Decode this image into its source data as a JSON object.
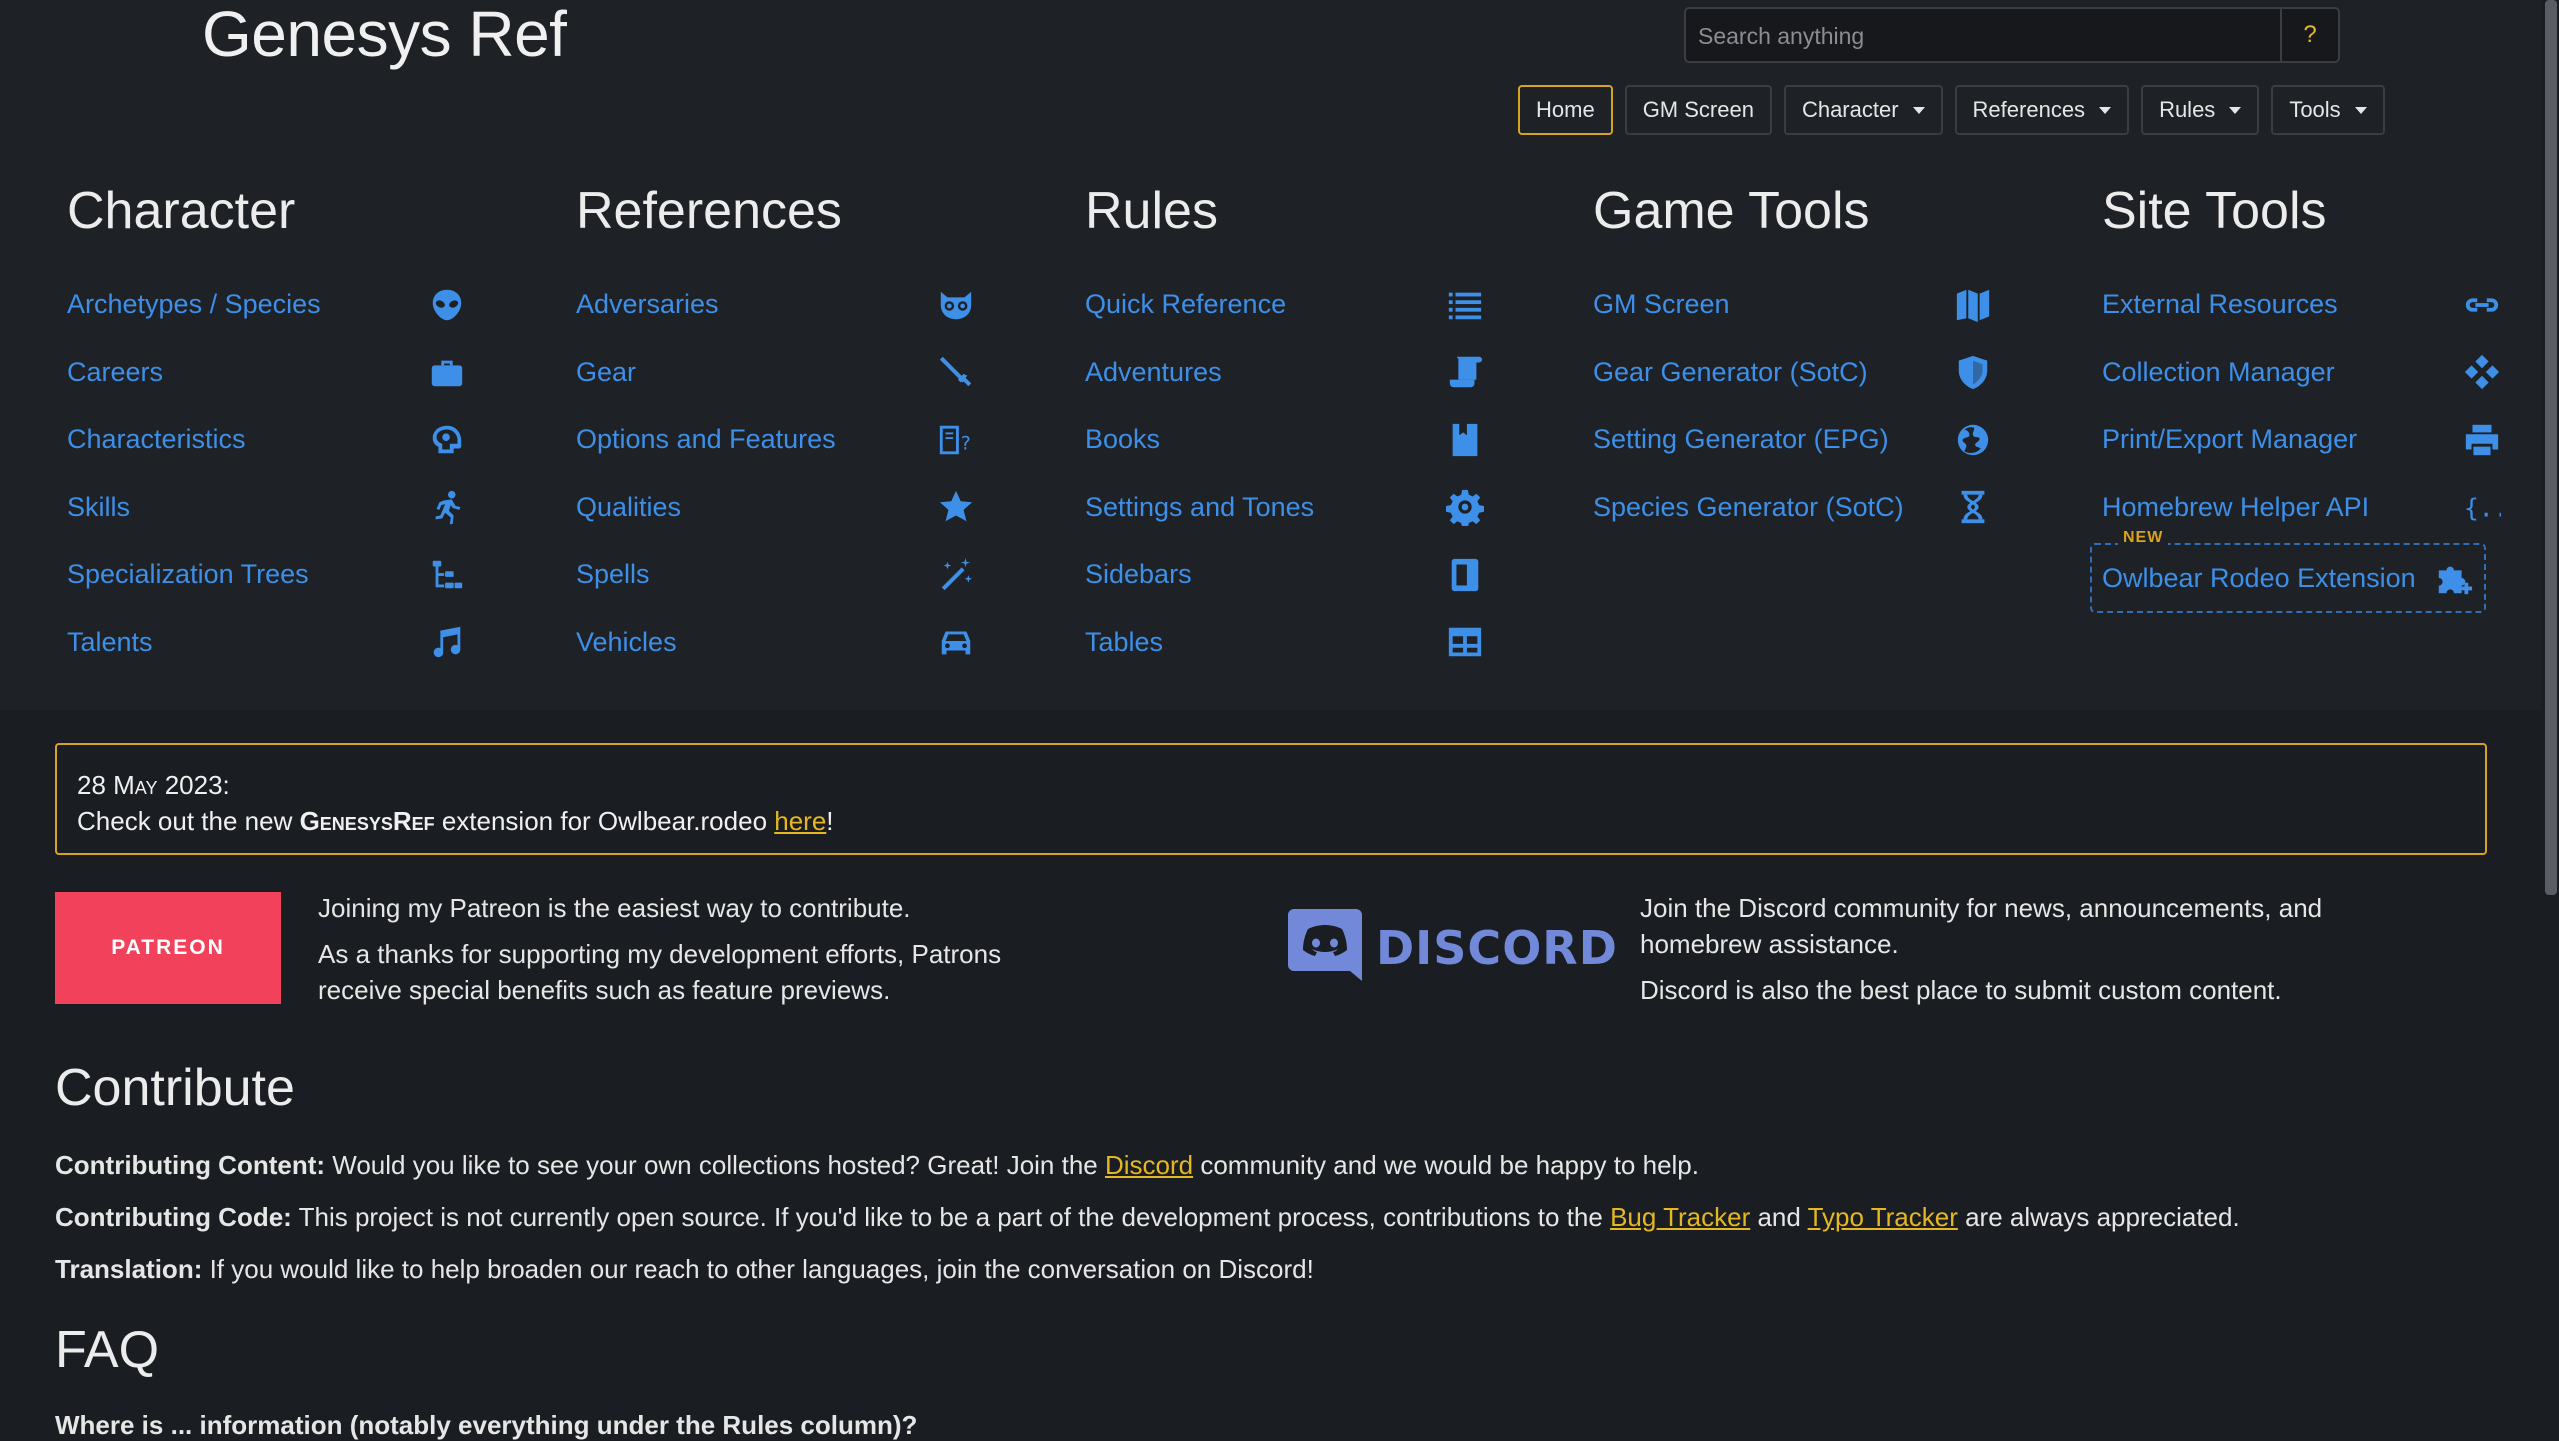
{
  "site": {
    "title": "Genesys Ref"
  },
  "search": {
    "placeholder": "Search anything",
    "help": "?"
  },
  "nav": [
    {
      "label": "Home"
    },
    {
      "label": "GM Screen"
    },
    {
      "label": "Character"
    },
    {
      "label": "References"
    },
    {
      "label": "Rules"
    },
    {
      "label": "Tools"
    }
  ],
  "columns": [
    {
      "heading": "Character",
      "items": [
        {
          "label": "Archetypes / Species",
          "icon": "alien-icon"
        },
        {
          "label": "Careers",
          "icon": "briefcase-icon"
        },
        {
          "label": "Characteristics",
          "icon": "brain-icon"
        },
        {
          "label": "Skills",
          "icon": "running-icon"
        },
        {
          "label": "Specialization Trees",
          "icon": "tree-icon"
        },
        {
          "label": "Talents",
          "icon": "music-icon"
        }
      ]
    },
    {
      "heading": "References",
      "items": [
        {
          "label": "Adversaries",
          "icon": "mask-icon"
        },
        {
          "label": "Gear",
          "icon": "sword-icon"
        },
        {
          "label": "Options and Features",
          "icon": "book-question-icon"
        },
        {
          "label": "Qualities",
          "icon": "star-icon"
        },
        {
          "label": "Spells",
          "icon": "magic-wand-icon"
        },
        {
          "label": "Vehicles",
          "icon": "car-icon"
        }
      ]
    },
    {
      "heading": "Rules",
      "items": [
        {
          "label": "Quick Reference",
          "icon": "list-icon"
        },
        {
          "label": "Adventures",
          "icon": "scroll-icon"
        },
        {
          "label": "Books",
          "icon": "book-icon"
        },
        {
          "label": "Settings and Tones",
          "icon": "gear-icon"
        },
        {
          "label": "Sidebars",
          "icon": "sidebar-icon"
        },
        {
          "label": "Tables",
          "icon": "table-icon"
        }
      ]
    },
    {
      "heading": "Game Tools",
      "items": [
        {
          "label": "GM Screen",
          "icon": "map-icon"
        },
        {
          "label": "Gear Generator (SotC)",
          "icon": "shield-icon"
        },
        {
          "label": "Setting Generator (EPG)",
          "icon": "globe-icon"
        },
        {
          "label": "Species Generator (SotC)",
          "icon": "dna-icon"
        }
      ]
    },
    {
      "heading": "Site Tools",
      "items": [
        {
          "label": "External Resources",
          "icon": "link-icon"
        },
        {
          "label": "Collection Manager",
          "icon": "diamonds-icon"
        },
        {
          "label": "Print/Export Manager",
          "icon": "printer-icon"
        },
        {
          "label": "Homebrew Helper API",
          "icon": "braces-icon"
        },
        {
          "label": "Owlbear Rodeo Extension",
          "icon": "puzzle-plus-icon",
          "badge": "NEW"
        }
      ]
    }
  ],
  "notice": {
    "date": "28 May 2023:",
    "text_before": "Check out the new ",
    "brand": "GenesysRef",
    "text_middle": " extension for Owlbear.rodeo ",
    "link": "here",
    "text_after": "!"
  },
  "patreon": {
    "button": "PATREON",
    "line1": "Joining my Patreon is the easiest way to contribute.",
    "line2": "As a thanks for supporting my development efforts, Patrons receive special benefits such as feature previews."
  },
  "discord": {
    "wordmark": "DISCORD",
    "line1": "Join the Discord community for news, announcements, and homebrew assistance.",
    "line2": "Discord is also the best place to submit custom content."
  },
  "contribute": {
    "heading": "Contribute",
    "content_label": "Contributing Content:",
    "content_before": " Would you like to see your own collections hosted? Great! Join the ",
    "content_link": "Discord",
    "content_after": " community and we would be happy to help.",
    "code_label": "Contributing Code:",
    "code_before": " This project is not currently open source. If you'd like to be a part of the development process, contributions to the ",
    "code_link1": "Bug Tracker",
    "code_and": " and ",
    "code_link2": "Typo Tracker",
    "code_after": " are always appreciated.",
    "translation_label": "Translation:",
    "translation_text": " If you would like to help broaden our reach to other languages, join the conversation on Discord!"
  },
  "faq": {
    "heading": "FAQ",
    "question": "Where is ... information (notably everything under the Rules column)?"
  },
  "colors": {
    "accent": "#3d8fe8",
    "gold": "#d8a321",
    "patreon": "#f2415a",
    "discord": "#7289da",
    "background": "#1a1d22"
  }
}
